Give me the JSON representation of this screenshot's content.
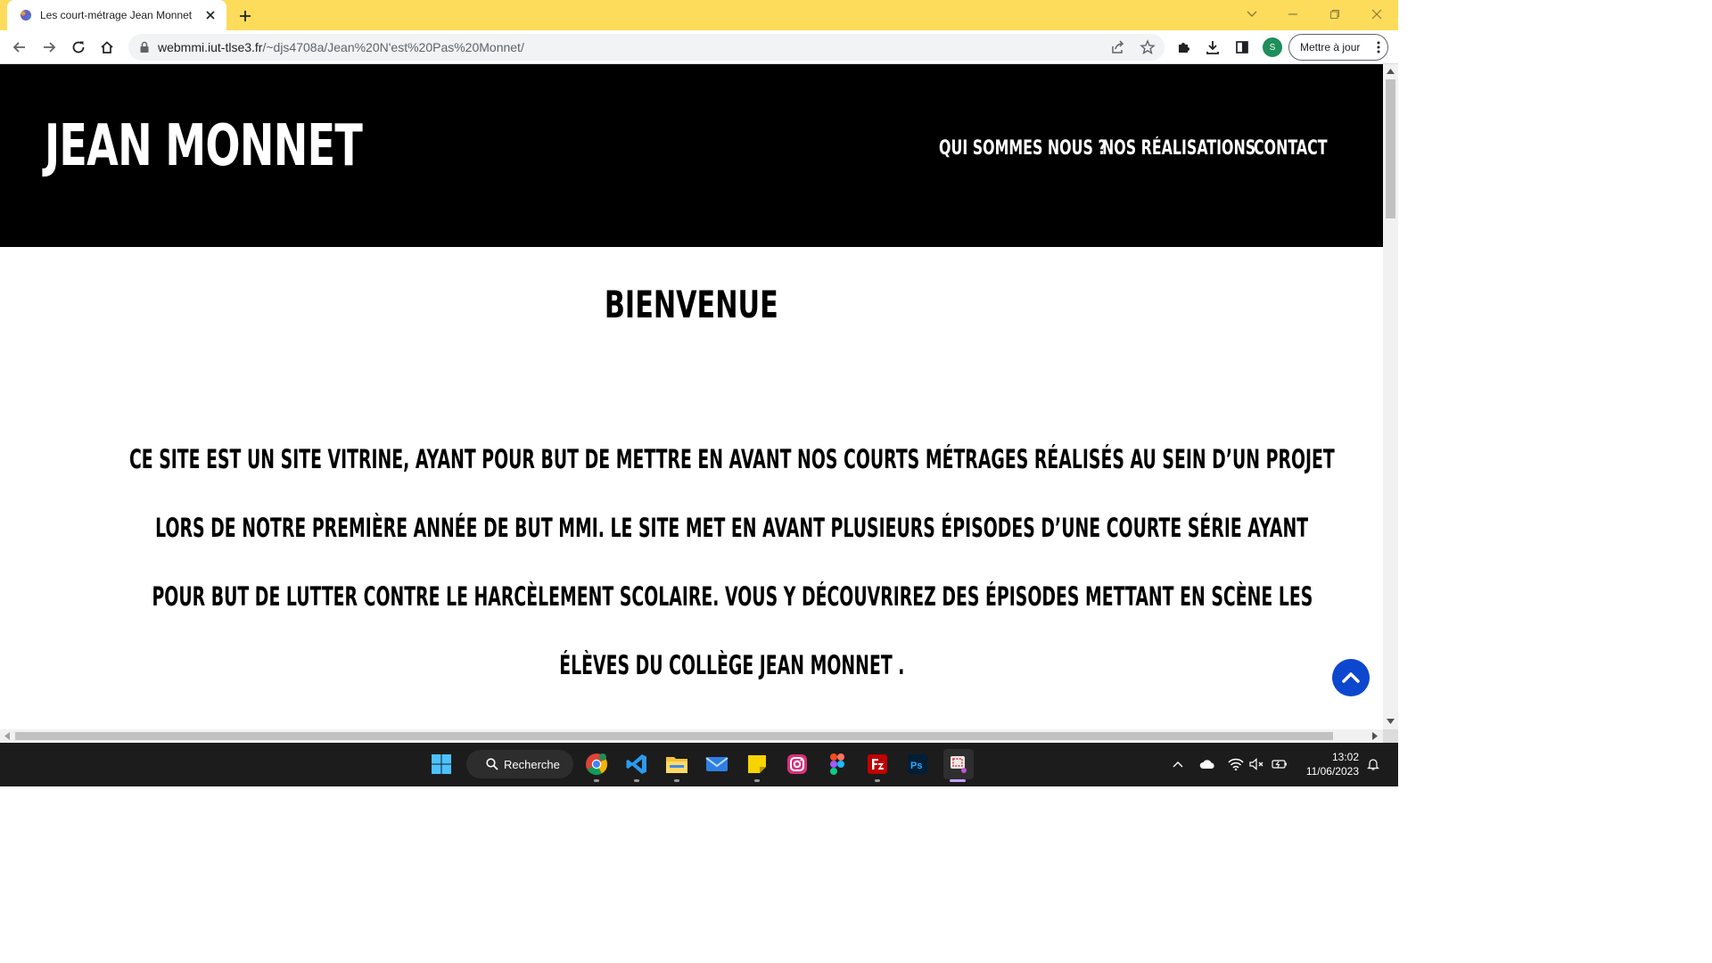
{
  "browser": {
    "tab_title": "Les court-métrage Jean Monnet",
    "url_host": "webmmi.iut-tlse3.fr",
    "url_path": "/~djs4708a/Jean%20N'est%20Pas%20Monnet/",
    "profile_initial": "S",
    "update_label": "Mettre à jour"
  },
  "site": {
    "logo": "JEAN MONNET",
    "nav": [
      {
        "label": "QUI SOMMES NOUS ?"
      },
      {
        "label": "NOS RÉALISATIONS"
      },
      {
        "label": "CONTACT"
      }
    ],
    "heading": "BIENVENUE",
    "intro_lines": [
      "CE SITE EST UN SITE VITRINE, AYANT POUR BUT DE METTRE EN AVANT NOS COURTS MÉTRAGES RÉALISÉS AU SEIN D’UN PROJET",
      "LORS DE NOTRE PREMIÈRE ANNÉE DE BUT MMI. LE SITE MET EN AVANT PLUSIEURS ÉPISODES D’UNE COURTE SÉRIE AYANT",
      "POUR BUT DE LUTTER CONTRE LE HARCÈLEMENT SCOLAIRE. VOUS Y DÉCOUVRIREZ DES ÉPISODES METTANT EN SCÈNE LES",
      "ÉLÈVES DU COLLÈGE JEAN MONNET ."
    ]
  },
  "taskbar": {
    "search_label": "Recherche",
    "time": "13:02",
    "date": "11/06/2023"
  },
  "icons": {
    "back": "back-arrow-icon",
    "forward": "forward-arrow-icon",
    "reload": "reload-icon",
    "home": "home-icon",
    "share": "share-icon",
    "bookmark": "star-icon",
    "extensions": "puzzle-icon",
    "download": "download-icon",
    "sidepanel": "side-panel-icon",
    "back_to_top": "chevron-up-icon"
  },
  "colors": {
    "tabstrip": "#FDDC5C",
    "header": "#000000",
    "back_to_top": "#0D47CE",
    "taskbar": "#1C1C1C"
  }
}
